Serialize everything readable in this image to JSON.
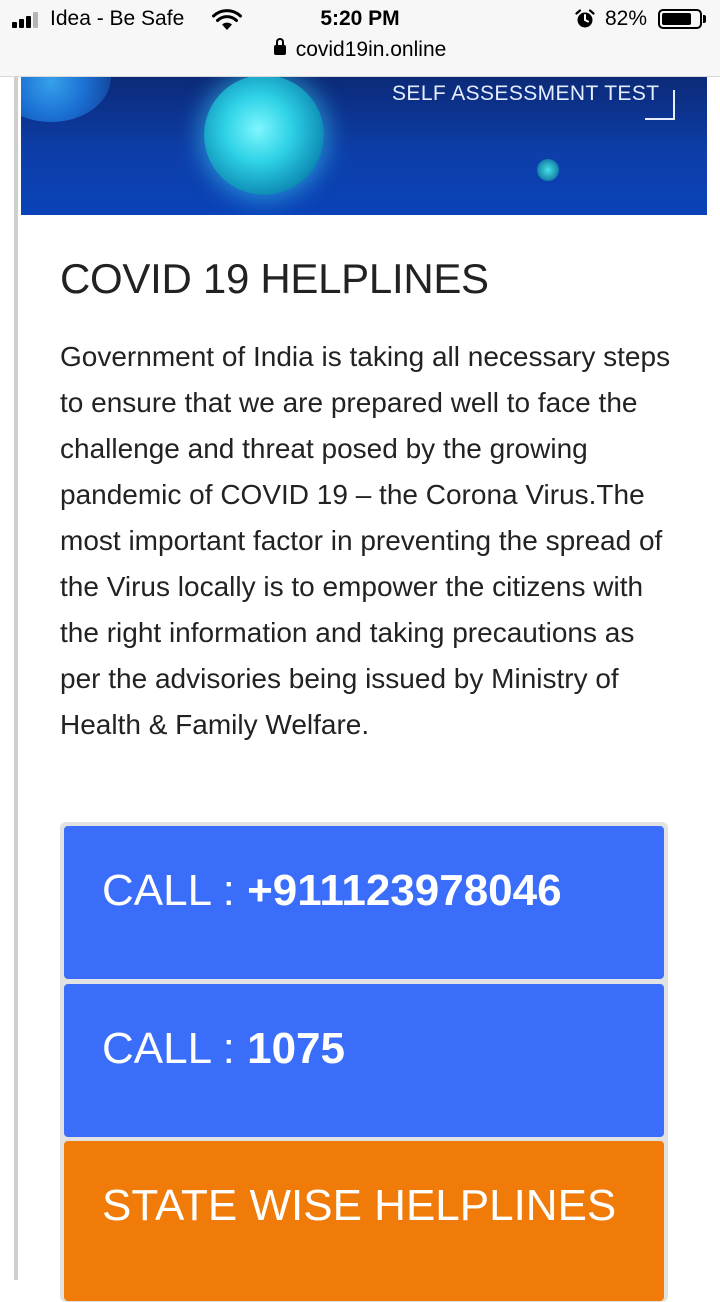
{
  "status_bar": {
    "carrier": "Idea - Be Safe",
    "time": "5:20 PM",
    "battery": "82%",
    "battery_level": 0.82,
    "url": "covid19in.online"
  },
  "hero": {
    "label": "SELF ASSESSMENT TEST"
  },
  "content": {
    "heading": "COVID 19 HELPLINES",
    "intro": "Government of India is taking all necessary steps to ensure that we are prepared well to face the challenge and threat posed by the growing pandemic of COVID 19 – the Corona Virus.The most important factor in preventing the spread of the Virus locally is to empower the citizens with the right information and taking precautions as per the advisories being issued by Ministry of Health & Family Welfare."
  },
  "buttons": {
    "call1_prefix": "CALL : ",
    "call1_number": "+911123978046",
    "call2_prefix": "CALL : ",
    "call2_number": "1075",
    "state_label": "STATE WISE HELPLINES"
  },
  "colors": {
    "call_button": "#3a6dfa",
    "state_button": "#f07b09",
    "hero_background": "#0d3ea9"
  },
  "icons": [
    "signal-icon",
    "wifi-icon",
    "alarm-icon",
    "battery-icon",
    "lock-icon",
    "virus-illustration"
  ]
}
